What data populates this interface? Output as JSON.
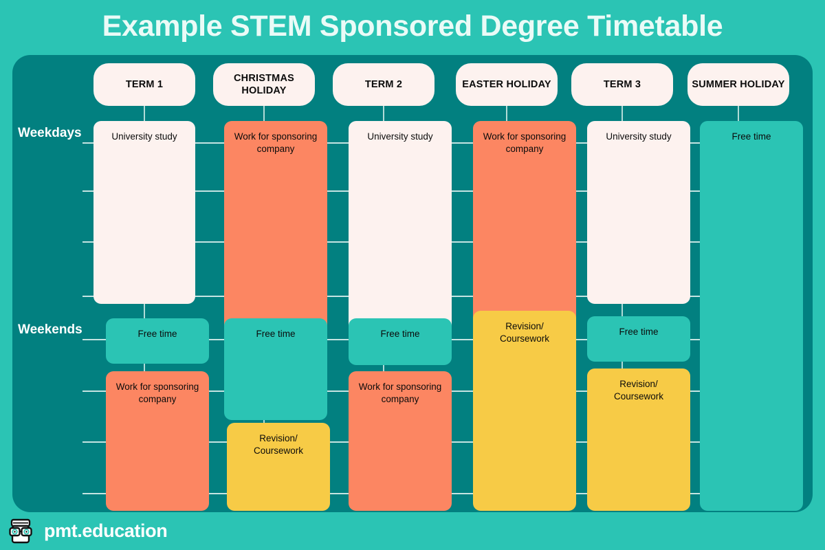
{
  "title": "Example STEM Sponsored Degree Timetable",
  "colors": {
    "outer_background": "#2BC4B4",
    "panel_background": "#028080",
    "title_text": "#EAFBF7",
    "header_pill": "#FDF2EF",
    "university_study": "#FDF2EF",
    "work_for_sponsor": "#FC8662",
    "free_time": "#2BC4B4",
    "revision_coursework": "#F7CB46",
    "gridline": "#E9F6F3"
  },
  "row_labels": [
    {
      "label": "Weekdays"
    },
    {
      "label": "Weekends"
    }
  ],
  "columns": [
    {
      "header": "TERM 1"
    },
    {
      "header": "CHRISTMAS HOLIDAY"
    },
    {
      "header": "TERM 2"
    },
    {
      "header": "EASTER HOLIDAY"
    },
    {
      "header": "TERM 3"
    },
    {
      "header": "SUMMER HOLIDAY"
    }
  ],
  "blocks": [
    {
      "column": "TERM 1",
      "row": "Weekdays",
      "label": "University study",
      "category": "university_study"
    },
    {
      "column": "CHRISTMAS HOLIDAY",
      "row": "Weekdays",
      "label": "Work for sponsoring company",
      "category": "work_for_sponsor"
    },
    {
      "column": "TERM 2",
      "row": "Weekdays",
      "label": "University study",
      "category": "university_study"
    },
    {
      "column": "EASTER HOLIDAY",
      "row": "Weekdays",
      "label": "Work for sponsoring company",
      "category": "work_for_sponsor"
    },
    {
      "column": "TERM 3",
      "row": "Weekdays",
      "label": "University study",
      "category": "university_study"
    },
    {
      "column": "SUMMER HOLIDAY",
      "row": "Weekdays",
      "label": "Free time",
      "category": "free_time"
    },
    {
      "column": "TERM 1",
      "row": "Weekends",
      "label": "Free time",
      "category": "free_time"
    },
    {
      "column": "TERM 1",
      "row": "Weekends",
      "label": "Work for sponsoring company",
      "category": "work_for_sponsor"
    },
    {
      "column": "CHRISTMAS HOLIDAY",
      "row": "Weekends",
      "label": "Free time",
      "category": "free_time"
    },
    {
      "column": "CHRISTMAS HOLIDAY",
      "row": "Weekends",
      "label": "Revision/ Coursework",
      "category": "revision_coursework"
    },
    {
      "column": "TERM 2",
      "row": "Weekends",
      "label": "Free time",
      "category": "free_time"
    },
    {
      "column": "TERM 2",
      "row": "Weekends",
      "label": "Work for sponsoring company",
      "category": "work_for_sponsor"
    },
    {
      "column": "EASTER HOLIDAY",
      "row": "Weekends",
      "label": "Revision/ Coursework",
      "category": "revision_coursework"
    },
    {
      "column": "TERM 3",
      "row": "Weekends",
      "label": "Free time",
      "category": "free_time"
    },
    {
      "column": "TERM 3",
      "row": "Weekends",
      "label": "Revision/ Coursework",
      "category": "revision_coursework"
    }
  ],
  "cells": {
    "term1_weekday": "University study",
    "christmas_weekday": "Work for sponsoring company",
    "term2_weekday": "University study",
    "easter_weekday": "Work for sponsoring company",
    "term3_weekday": "University study",
    "summer_weekday": "Free time",
    "term1_weekend_a": "Free time",
    "term1_weekend_b": "Work for sponsoring company",
    "christmas_weekend_a": "Free time",
    "christmas_weekend_b_l1": "Revision/",
    "christmas_weekend_b_l2": "Coursework",
    "term2_weekend_a": "Free time",
    "term2_weekend_b": "Work for sponsoring company",
    "easter_weekend_l1": "Revision/",
    "easter_weekend_l2": "Coursework",
    "term3_weekend_a": "Free time",
    "term3_weekend_b_l1": "Revision/",
    "term3_weekend_b_l2": "Coursework"
  },
  "footer": {
    "brand": "pmt.education",
    "logo_icon": "pmt-book-glasses-logo"
  }
}
